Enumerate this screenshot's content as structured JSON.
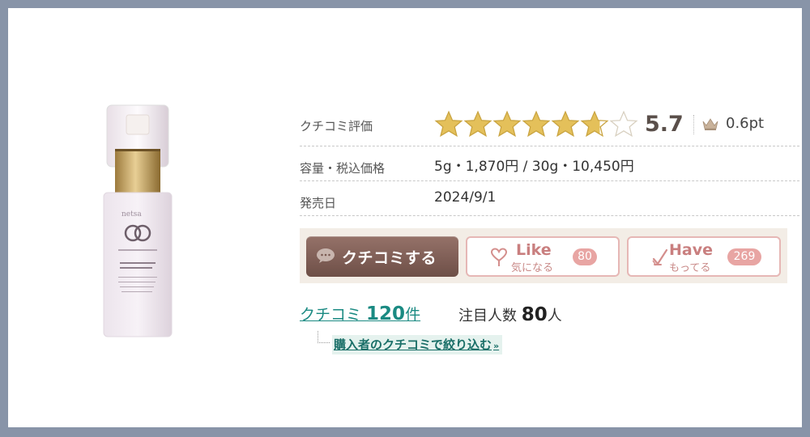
{
  "spec": {
    "rating_label": "クチコミ評価",
    "rating_value": 5.7,
    "rating_text": "5.7",
    "points": "0.6pt",
    "capacity_label": "容量・税込価格",
    "capacity_value": "5g・1,870円 / 30g・10,450円",
    "release_label": "発売日",
    "release_value": "2024/9/1"
  },
  "actions": {
    "review_button": "クチコミする",
    "like": {
      "title": "Like",
      "subtitle": "気になる",
      "count": "80"
    },
    "have": {
      "title": "Have",
      "subtitle": "もってる",
      "count": "269"
    }
  },
  "summary": {
    "review_prefix": "クチコミ ",
    "review_count": "120",
    "review_suffix": "件",
    "attention_prefix": "注目人数 ",
    "attention_count": "80",
    "attention_suffix": "人",
    "filter_link": "購入者のクチコミで絞り込む",
    "filter_arrow": "»"
  },
  "icons": {
    "star": "star-icon",
    "crown": "crown-icon",
    "comment": "speech-bubble-icon",
    "like": "heart-icon",
    "have": "check-hand-icon"
  },
  "colors": {
    "star_fill": "#e4c05a",
    "star_empty": "#d8d0c0",
    "accent_link": "#1a8a82",
    "review_button": "#7a5a52",
    "like_border": "#e6b7b5"
  }
}
